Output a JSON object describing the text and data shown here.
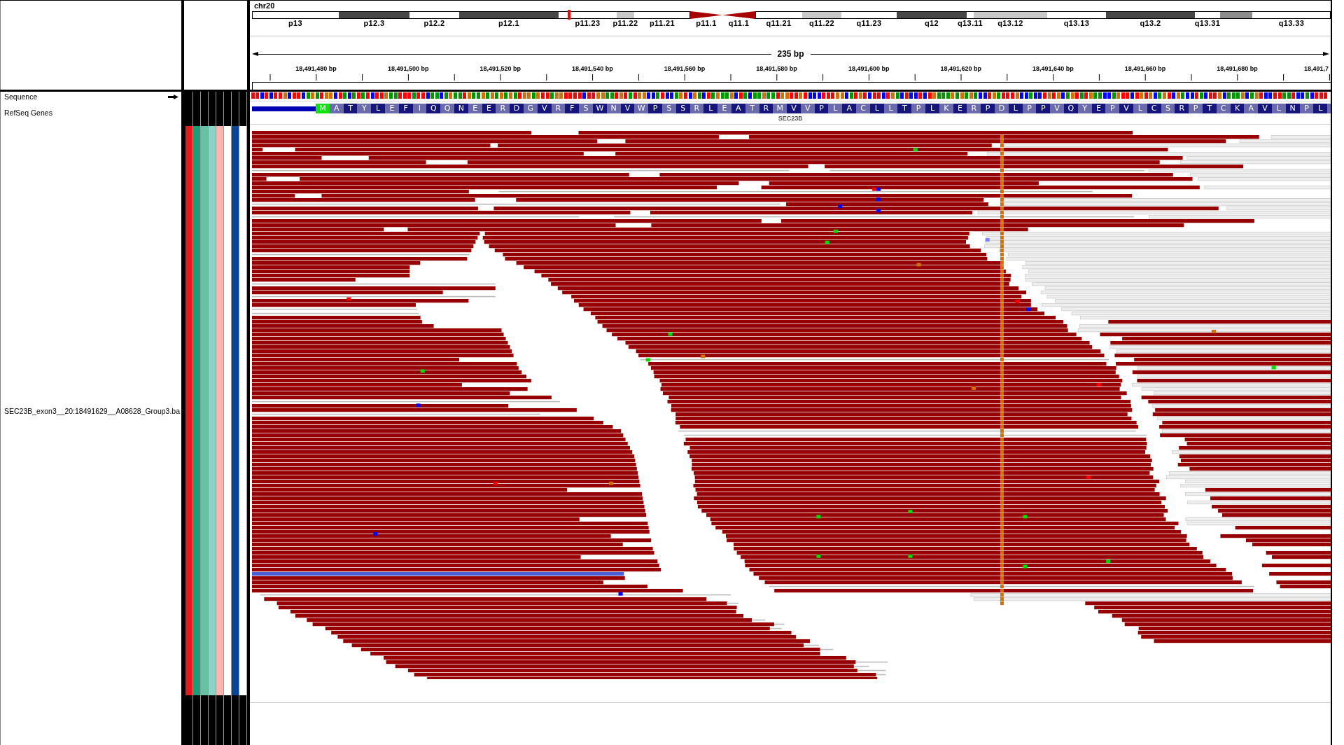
{
  "locus": {
    "chromosome": "chr20"
  },
  "ideogram": {
    "bands": [
      {
        "label": "p13",
        "kind": "gneg",
        "current": false
      },
      {
        "label": "p12.3",
        "kind": "gpos75",
        "current": false
      },
      {
        "label": "p12.2",
        "kind": "gneg",
        "current": false
      },
      {
        "label": "p12.1",
        "kind": "gpos75",
        "current": false
      },
      {
        "label": "p11.23",
        "kind": "gneg",
        "current": true
      },
      {
        "label": "p11.22",
        "kind": "gpos25",
        "current": false
      },
      {
        "label": "p11.21",
        "kind": "gneg",
        "current": false
      },
      {
        "label": "p11.1",
        "kind": "acen",
        "current": false
      },
      {
        "label": "q11.1",
        "kind": "acen",
        "current": false
      },
      {
        "label": "q11.21",
        "kind": "gneg",
        "current": false
      },
      {
        "label": "q11.22",
        "kind": "gpos25",
        "current": false
      },
      {
        "label": "q11.23",
        "kind": "gneg",
        "current": false
      },
      {
        "label": "q12",
        "kind": "gpos75",
        "current": false
      },
      {
        "label": "q13.11",
        "kind": "gneg",
        "current": false
      },
      {
        "label": "q13.12",
        "kind": "gpos25",
        "current": false
      },
      {
        "label": "q13.13",
        "kind": "gneg",
        "current": false
      },
      {
        "label": "q13.2",
        "kind": "gpos75",
        "current": false
      },
      {
        "label": "q13.31",
        "kind": "gneg",
        "current": false
      },
      {
        "kind": "gpos50",
        "current": false
      },
      {
        "label": "q13.33",
        "kind": "gneg",
        "current": false
      }
    ]
  },
  "ruler": {
    "span": "235 bp",
    "ticks": [
      "18,491,480 bp",
      "18,491,500 bp",
      "18,491,520 bp",
      "18,491,540 bp",
      "18,491,560 bp",
      "18,491,580 bp",
      "18,491,600 bp",
      "18,491,620 bp",
      "18,491,640 bp",
      "18,491,660 bp",
      "18,491,680 bp",
      "18,491,7"
    ]
  },
  "tracks": [
    {
      "kind": "sequence",
      "name": "Sequence",
      "forward": true,
      "bases": [
        {
          "color": "#ff0000"
        },
        {
          "color": "#ff0000"
        },
        {
          "color": "#0000ff"
        },
        {
          "color": "#ff0000"
        },
        {
          "color": "#0000ff"
        },
        {
          "color": "#ff0000"
        },
        {
          "color": "#ff0000"
        },
        {
          "color": "#d17105"
        },
        {
          "color": "#0000ff"
        },
        {
          "color": "#ff0000"
        },
        {
          "color": "#ff0000"
        },
        {
          "color": "#0000ff"
        },
        {
          "color": "#009600"
        },
        {
          "color": "#d17105"
        },
        {
          "color": "#009600"
        },
        {
          "color": "#ff0000"
        },
        {
          "color": "#d17105"
        },
        {
          "color": "#d17105"
        },
        {
          "color": "#0000ff"
        },
        {
          "color": "#ff0000"
        },
        {
          "color": "#009600"
        },
        {
          "color": "#0000ff"
        },
        {
          "color": "#009600"
        },
        {
          "color": "#ff0000"
        },
        {
          "color": "#009600"
        },
        {
          "color": "#ff0000"
        },
        {
          "color": "#0000ff"
        },
        {
          "color": "#ff0000"
        },
        {
          "color": "#ff0000"
        },
        {
          "color": "#d17105"
        },
        {
          "color": "#009600"
        },
        {
          "color": "#009600"
        },
        {
          "color": "#ff0000"
        },
        {
          "color": "#ff0000"
        },
        {
          "color": "#ff0000"
        },
        {
          "color": "#009600"
        },
        {
          "color": "#ff0000"
        },
        {
          "color": "#ff0000"
        },
        {
          "color": "#0000ff"
        },
        {
          "color": "#009600"
        },
        {
          "color": "#009600"
        },
        {
          "color": "#0000ff"
        },
        {
          "color": "#009600"
        },
        {
          "color": "#d17105"
        },
        {
          "color": "#009600"
        },
        {
          "color": "#009600"
        },
        {
          "color": "#ff0000"
        },
        {
          "color": "#d17105"
        },
        {
          "color": "#009600"
        },
        {
          "color": "#009600"
        },
        {
          "color": "#d17105"
        },
        {
          "color": "#009600"
        },
        {
          "color": "#d17105"
        },
        {
          "color": "#009600"
        },
        {
          "color": "#d17105"
        },
        {
          "color": "#009600"
        },
        {
          "color": "#d17105"
        },
        {
          "color": "#009600"
        },
        {
          "color": "#ff0000"
        },
        {
          "color": "#d17105"
        },
        {
          "color": "#d17105"
        },
        {
          "color": "#009600"
        },
        {
          "color": "#d17105"
        },
        {
          "color": "#ff0000"
        },
        {
          "color": "#ff0000"
        },
        {
          "color": "#009600"
        },
        {
          "color": "#d17105"
        },
        {
          "color": "#d17105"
        },
        {
          "color": "#ff0000"
        },
        {
          "color": "#ff0000"
        },
        {
          "color": "#ff0000"
        },
        {
          "color": "#ff0000"
        },
        {
          "color": "#0000ff"
        },
        {
          "color": "#ff0000"
        },
        {
          "color": "#ff0000"
        },
        {
          "color": "#d17105"
        },
        {
          "color": "#d17105"
        },
        {
          "color": "#009600"
        },
        {
          "color": "#009600"
        },
        {
          "color": "#ff0000"
        },
        {
          "color": "#d17105"
        },
        {
          "color": "#ff0000"
        },
        {
          "color": "#009600"
        },
        {
          "color": "#ff0000"
        },
        {
          "color": "#d17105"
        },
        {
          "color": "#d17105"
        },
        {
          "color": "#0000ff"
        },
        {
          "color": "#0000ff"
        },
        {
          "color": "#009600"
        },
        {
          "color": "#ff0000"
        },
        {
          "color": "#0000ff"
        },
        {
          "color": "#0000ff"
        },
        {
          "color": "#009600"
        },
        {
          "color": "#d17105"
        },
        {
          "color": "#ff0000"
        },
        {
          "color": "#0000ff"
        },
        {
          "color": "#d17105"
        },
        {
          "color": "#009600"
        },
        {
          "color": "#0000ff"
        },
        {
          "color": "#ff0000"
        },
        {
          "color": "#009600"
        },
        {
          "color": "#d17105"
        },
        {
          "color": "#009600"
        },
        {
          "color": "#009600"
        },
        {
          "color": "#d17105"
        },
        {
          "color": "#0000ff"
        },
        {
          "color": "#ff0000"
        },
        {
          "color": "#009600"
        },
        {
          "color": "#0000ff"
        },
        {
          "color": "#009600"
        },
        {
          "color": "#009600"
        },
        {
          "color": "#d17105"
        },
        {
          "color": "#009600"
        },
        {
          "color": "#009600"
        },
        {
          "color": "#ff0000"
        },
        {
          "color": "#d17105"
        },
        {
          "color": "#d17105"
        },
        {
          "color": "#ff0000"
        },
        {
          "color": "#ff0000"
        },
        {
          "color": "#d17105"
        },
        {
          "color": "#ff0000"
        },
        {
          "color": "#0000ff"
        },
        {
          "color": "#0000ff"
        },
        {
          "color": "#0000ff"
        },
        {
          "color": "#ff0000"
        },
        {
          "color": "#ff0000"
        },
        {
          "color": "#ff0000"
        },
        {
          "color": "#d17105"
        },
        {
          "color": "#d17105"
        },
        {
          "color": "#0000ff"
        },
        {
          "color": "#009600"
        },
        {
          "color": "#ff0000"
        },
        {
          "color": "#d17105"
        },
        {
          "color": "#ff0000"
        },
        {
          "color": "#0000ff"
        },
        {
          "color": "#ff0000"
        },
        {
          "color": "#ff0000"
        },
        {
          "color": "#0000ff"
        },
        {
          "color": "#ff0000"
        },
        {
          "color": "#d17105"
        },
        {
          "color": "#009600"
        },
        {
          "color": "#0000ff"
        },
        {
          "color": "#ff0000"
        },
        {
          "color": "#0000ff"
        },
        {
          "color": "#0000ff"
        },
        {
          "color": "#ff0000"
        },
        {
          "color": "#0000ff"
        },
        {
          "color": "#ff0000"
        },
        {
          "color": "#d17105"
        },
        {
          "color": "#009600"
        },
        {
          "color": "#009600"
        },
        {
          "color": "#009600"
        },
        {
          "color": "#d17105"
        },
        {
          "color": "#009600"
        },
        {
          "color": "#d17105"
        },
        {
          "color": "#009600"
        },
        {
          "color": "#d17105"
        },
        {
          "color": "#009600"
        },
        {
          "color": "#0000ff"
        },
        {
          "color": "#0000ff"
        },
        {
          "color": "#ff0000"
        },
        {
          "color": "#d17105"
        },
        {
          "color": "#009600"
        },
        {
          "color": "#ff0000"
        },
        {
          "color": "#ff0000"
        },
        {
          "color": "#ff0000"
        },
        {
          "color": "#d17105"
        },
        {
          "color": "#0000ff"
        },
        {
          "color": "#0000ff"
        },
        {
          "color": "#009600"
        },
        {
          "color": "#0000ff"
        },
        {
          "color": "#0000ff"
        },
        {
          "color": "#ff0000"
        },
        {
          "color": "#d17105"
        },
        {
          "color": "#ff0000"
        },
        {
          "color": "#d17105"
        },
        {
          "color": "#0000ff"
        },
        {
          "color": "#009600"
        },
        {
          "color": "#d17105"
        },
        {
          "color": "#ff0000"
        },
        {
          "color": "#009600"
        },
        {
          "color": "#ff0000"
        },
        {
          "color": "#d17105"
        },
        {
          "color": "#009600"
        },
        {
          "color": "#009600"
        },
        {
          "color": "#0000ff"
        },
        {
          "color": "#0000ff"
        },
        {
          "color": "#009600"
        },
        {
          "color": "#d17105"
        },
        {
          "color": "#ff0000"
        },
        {
          "color": "#ff0000"
        },
        {
          "color": "#0000ff"
        },
        {
          "color": "#ff0000"
        },
        {
          "color": "#d17105"
        },
        {
          "color": "#ff0000"
        },
        {
          "color": "#d17105"
        },
        {
          "color": "#0000ff"
        },
        {
          "color": "#009600"
        },
        {
          "color": "#d17105"
        },
        {
          "color": "#ff0000"
        },
        {
          "color": "#0000ff"
        },
        {
          "color": "#d17105"
        },
        {
          "color": "#009600"
        },
        {
          "color": "#0000ff"
        },
        {
          "color": "#0000ff"
        },
        {
          "color": "#ff0000"
        },
        {
          "color": "#009600"
        },
        {
          "color": "#0000ff"
        },
        {
          "color": "#ff0000"
        },
        {
          "color": "#ff0000"
        },
        {
          "color": "#d17105"
        },
        {
          "color": "#0000ff"
        },
        {
          "color": "#009600"
        },
        {
          "color": "#009600"
        },
        {
          "color": "#009600"
        },
        {
          "color": "#d17105"
        },
        {
          "color": "#0000ff"
        },
        {
          "color": "#009600"
        },
        {
          "color": "#d17105"
        },
        {
          "color": "#ff0000"
        },
        {
          "color": "#0000ff"
        },
        {
          "color": "#0000ff"
        },
        {
          "color": "#ff0000"
        },
        {
          "color": "#ff0000"
        },
        {
          "color": "#009600"
        },
        {
          "color": "#009600"
        },
        {
          "color": "#ff0000"
        },
        {
          "color": "#0000ff"
        },
        {
          "color": "#0000ff"
        },
        {
          "color": "#009600"
        },
        {
          "color": "#0000ff"
        },
        {
          "color": "#ff0000"
        },
        {
          "color": "#ff0000"
        },
        {
          "color": "#ff0000"
        }
      ]
    },
    {
      "kind": "gene",
      "name": "RefSeq Genes",
      "gene": "SEC23B",
      "codons": [
        {
          "letter": "M",
          "kind": "start"
        },
        {
          "letter": "A",
          "kind": "codon"
        },
        {
          "letter": "T",
          "kind": "codon"
        },
        {
          "letter": "Y",
          "kind": "codon"
        },
        {
          "letter": "L",
          "kind": "codon"
        },
        {
          "letter": "E",
          "kind": "codon"
        },
        {
          "letter": "F",
          "kind": "codon"
        },
        {
          "letter": "I",
          "kind": "codon"
        },
        {
          "letter": "Q",
          "kind": "codon"
        },
        {
          "letter": "Q",
          "kind": "codon"
        },
        {
          "letter": "N",
          "kind": "codon"
        },
        {
          "letter": "E",
          "kind": "codon"
        },
        {
          "letter": "E",
          "kind": "codon"
        },
        {
          "letter": "R",
          "kind": "codon"
        },
        {
          "letter": "D",
          "kind": "codon"
        },
        {
          "letter": "G",
          "kind": "codon"
        },
        {
          "letter": "V",
          "kind": "codon"
        },
        {
          "letter": "R",
          "kind": "codon"
        },
        {
          "letter": "F",
          "kind": "codon"
        },
        {
          "letter": "S",
          "kind": "codon"
        },
        {
          "letter": "W",
          "kind": "codon"
        },
        {
          "letter": "N",
          "kind": "codon"
        },
        {
          "letter": "V",
          "kind": "codon"
        },
        {
          "letter": "W",
          "kind": "codon"
        },
        {
          "letter": "P",
          "kind": "codon"
        },
        {
          "letter": "S",
          "kind": "codon"
        },
        {
          "letter": "S",
          "kind": "codon"
        },
        {
          "letter": "R",
          "kind": "codon"
        },
        {
          "letter": "L",
          "kind": "codon"
        },
        {
          "letter": "E",
          "kind": "codon"
        },
        {
          "letter": "A",
          "kind": "codon"
        },
        {
          "letter": "T",
          "kind": "codon"
        },
        {
          "letter": "R",
          "kind": "codon"
        },
        {
          "letter": "M",
          "kind": "codon"
        },
        {
          "letter": "V",
          "kind": "codon"
        },
        {
          "letter": "V",
          "kind": "codon"
        },
        {
          "letter": "P",
          "kind": "codon"
        },
        {
          "letter": "L",
          "kind": "codon"
        },
        {
          "letter": "A",
          "kind": "codon"
        },
        {
          "letter": "C",
          "kind": "codon"
        },
        {
          "letter": "L",
          "kind": "codon"
        },
        {
          "letter": "L",
          "kind": "codon"
        },
        {
          "letter": "T",
          "kind": "codon"
        },
        {
          "letter": "P",
          "kind": "codon"
        },
        {
          "letter": "L",
          "kind": "codon"
        },
        {
          "letter": "K",
          "kind": "codon"
        },
        {
          "letter": "E",
          "kind": "codon"
        },
        {
          "letter": "R",
          "kind": "codon"
        },
        {
          "letter": "P",
          "kind": "codon"
        },
        {
          "letter": "D",
          "kind": "codon"
        },
        {
          "letter": "L",
          "kind": "codon"
        },
        {
          "letter": "P",
          "kind": "codon"
        },
        {
          "letter": "P",
          "kind": "codon"
        },
        {
          "letter": "V",
          "kind": "codon"
        },
        {
          "letter": "Q",
          "kind": "codon"
        },
        {
          "letter": "Y",
          "kind": "codon"
        },
        {
          "letter": "E",
          "kind": "codon"
        },
        {
          "letter": "P",
          "kind": "codon"
        },
        {
          "letter": "V",
          "kind": "codon"
        },
        {
          "letter": "L",
          "kind": "codon"
        },
        {
          "letter": "C",
          "kind": "codon"
        },
        {
          "letter": "S",
          "kind": "codon"
        },
        {
          "letter": "R",
          "kind": "codon"
        },
        {
          "letter": "P",
          "kind": "codon"
        },
        {
          "letter": "T",
          "kind": "codon"
        },
        {
          "letter": "C",
          "kind": "codon"
        },
        {
          "letter": "K",
          "kind": "codon"
        },
        {
          "letter": "A",
          "kind": "codon"
        },
        {
          "letter": "V",
          "kind": "codon"
        },
        {
          "letter": "L",
          "kind": "codon"
        },
        {
          "letter": "N",
          "kind": "codon"
        },
        {
          "letter": "P",
          "kind": "codon"
        },
        {
          "letter": "L",
          "kind": "codon"
        }
      ]
    },
    {
      "kind": "alignment",
      "name": "SEC23B_exon3__20:18491629__A08628_Group3.ba",
      "attributes": [
        {
          "color": "#e41a1c"
        },
        {
          "color": "#1b9e77"
        },
        {
          "color": "#66c2a5"
        },
        {
          "color": "#8dd3c7"
        },
        {
          "color": "#fbb4ae"
        },
        {
          "color": "#ffffff"
        },
        {
          "color": "#084594"
        },
        {
          "color": "#ffffff"
        }
      ]
    }
  ]
}
